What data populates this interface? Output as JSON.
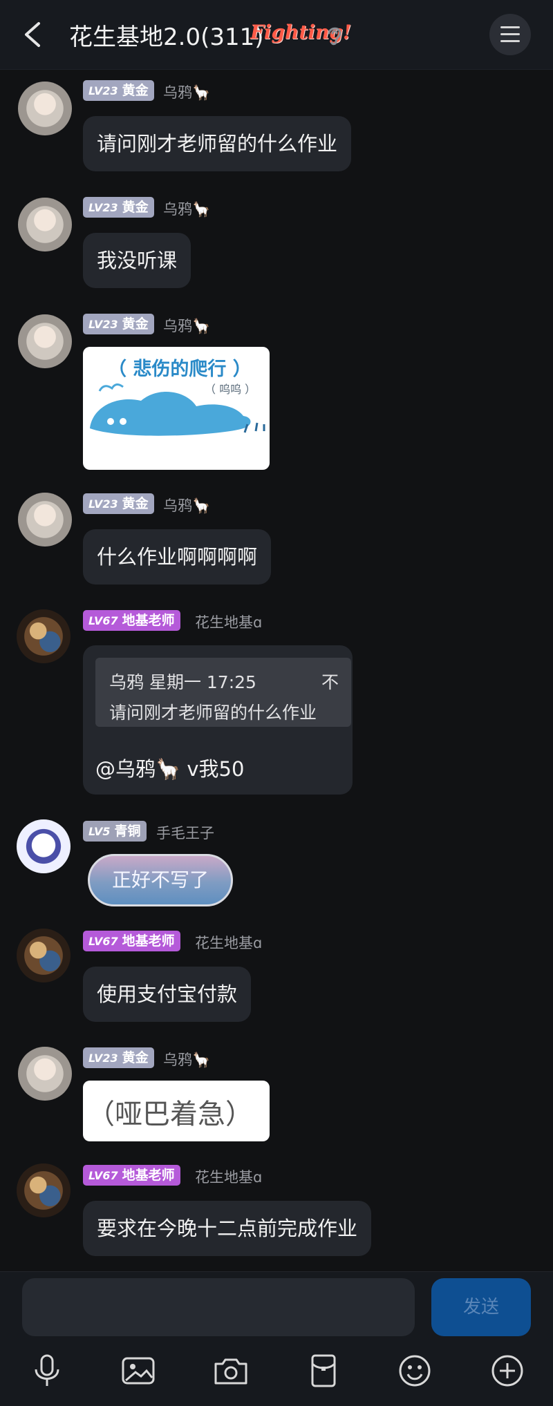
{
  "header": {
    "title": "花生基地2.0(311)",
    "badge_text": "Fighting!"
  },
  "messages": [
    {
      "level": "LV23",
      "rank": "黄金",
      "user": "乌鸦🦙",
      "text": "请问刚才老师留的什么作业"
    },
    {
      "level": "LV23",
      "rank": "黄金",
      "user": "乌鸦🦙",
      "text": "我没听课"
    },
    {
      "level": "LV23",
      "rank": "黄金",
      "user": "乌鸦🦙",
      "sticker_title": "（ 悲伤的爬行 ）",
      "sticker_note": "（ 呜呜 ）"
    },
    {
      "level": "LV23",
      "rank": "黄金",
      "user": "乌鸦🦙",
      "text": "什么作业啊啊啊啊"
    },
    {
      "level": "LV67",
      "rank": "地基老师",
      "user": "花生地基ɑ",
      "quote_meta": "乌鸦 星期一 17:25",
      "quote_text": "请问刚才老师留的什么作业",
      "quote_icon": "不",
      "text": "@乌鸦🦙 v我50"
    },
    {
      "level": "LV5",
      "rank": "青铜",
      "user": "手毛王子",
      "capsule": "正好不写了"
    },
    {
      "level": "LV67",
      "rank": "地基老师",
      "user": "花生地基ɑ",
      "text": "使用支付宝付款"
    },
    {
      "level": "LV23",
      "rank": "黄金",
      "user": "乌鸦🦙",
      "sticker_text": "（哑巴着急）"
    },
    {
      "level": "LV67",
      "rank": "地基老师",
      "user": "花生地基ɑ",
      "text": "要求在今晚十二点前完成作业"
    }
  ],
  "composer": {
    "placeholder": "",
    "send_label": "发送"
  },
  "toolbar": [
    "mic-icon",
    "image-icon",
    "camera-icon",
    "red-packet-icon",
    "emoji-icon",
    "plus-icon"
  ],
  "colors": {
    "background": "#111214",
    "bubble": "#24272d",
    "gold_badge": "#a2a6bf",
    "teacher_badge": "#b55ad9",
    "send_button": "#0e4f92"
  }
}
